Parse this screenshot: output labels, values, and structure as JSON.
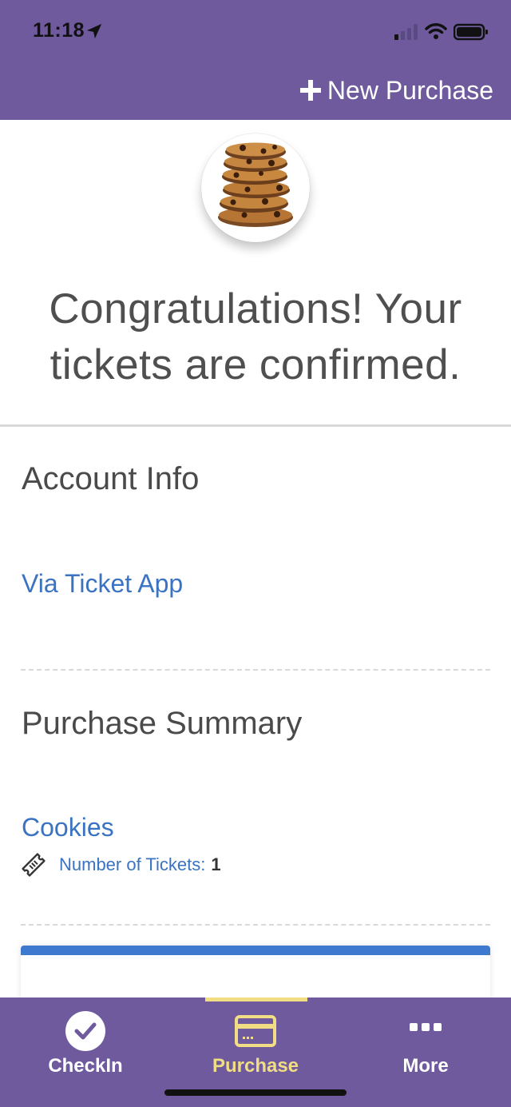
{
  "status_bar": {
    "time": "11:18"
  },
  "header": {
    "new_purchase_label": "New Purchase"
  },
  "main": {
    "headline": "Congratulations! Your tickets are confirmed.",
    "account_section_title": "Account Info",
    "account_link": "Via Ticket App",
    "summary_section_title": "Purchase Summary",
    "item_name": "Cookies",
    "tickets_label": "Number of Tickets:",
    "tickets_value": "1"
  },
  "bottom_nav": {
    "items": [
      {
        "label": "CheckIn",
        "icon": "check-circle-icon"
      },
      {
        "label": "Purchase",
        "icon": "credit-card-icon"
      },
      {
        "label": "More",
        "icon": "more-icon"
      }
    ],
    "selected": "Purchase"
  },
  "colors": {
    "brand_purple": "#6f5a9d",
    "active_yellow": "#f1dd84",
    "link_blue": "#3a73c1",
    "card_accent": "#3d79cf"
  }
}
